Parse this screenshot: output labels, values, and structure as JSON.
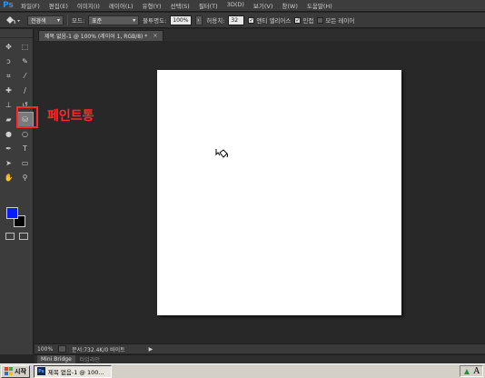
{
  "menubar": {
    "logo": "Ps",
    "items": [
      "파일(F)",
      "편집(E)",
      "이미지(I)",
      "레이어(L)",
      "유형(Y)",
      "선택(S)",
      "필터(T)",
      "3D(D)",
      "보기(V)",
      "창(W)",
      "도움말(H)"
    ]
  },
  "options": {
    "fill_source": "전경색",
    "mode_label": "모드:",
    "mode_value": "표준",
    "opacity_label": "불투명도:",
    "opacity_value": "100%",
    "tolerance_label": "허용치:",
    "tolerance_value": "32",
    "antialias_label": "앤티 앨리어스",
    "antialias_checked": true,
    "contiguous_label": "인접",
    "contiguous_checked": true,
    "all_layers_label": "모든 레이어",
    "all_layers_checked": false
  },
  "document": {
    "tab_title": "제목 없음-1 @ 100% (레이어 1, RGB/8) *",
    "close_glyph": "×",
    "canvas_color": "#ffffff"
  },
  "tools": [
    {
      "name": "move-tool-icon",
      "glyph": "✥"
    },
    {
      "name": "marquee-tool-icon",
      "glyph": "⬚"
    },
    {
      "name": "lasso-tool-icon",
      "glyph": "ↄ"
    },
    {
      "name": "quick-select-tool-icon",
      "glyph": "✎"
    },
    {
      "name": "crop-tool-icon",
      "glyph": "⌗"
    },
    {
      "name": "eyedropper-tool-icon",
      "glyph": "⁄"
    },
    {
      "name": "healing-brush-tool-icon",
      "glyph": "✚"
    },
    {
      "name": "brush-tool-icon",
      "glyph": "∕"
    },
    {
      "name": "clone-stamp-tool-icon",
      "glyph": "⊥"
    },
    {
      "name": "history-brush-tool-icon",
      "glyph": "↺"
    },
    {
      "name": "eraser-tool-icon",
      "glyph": "▰"
    },
    {
      "name": "paint-bucket-tool-icon",
      "glyph": "⛁",
      "active": true
    },
    {
      "name": "blur-tool-icon",
      "glyph": "●"
    },
    {
      "name": "dodge-tool-icon",
      "glyph": "○"
    },
    {
      "name": "pen-tool-icon",
      "glyph": "✒"
    },
    {
      "name": "type-tool-icon",
      "glyph": "T"
    },
    {
      "name": "path-select-tool-icon",
      "glyph": "➤"
    },
    {
      "name": "shape-tool-icon",
      "glyph": "▭"
    },
    {
      "name": "hand-tool-icon",
      "glyph": "✋"
    },
    {
      "name": "zoom-tool-icon",
      "glyph": "⚲"
    }
  ],
  "colors": {
    "foreground": "#0a1aff",
    "background": "#000000",
    "annotation": "#ff2a2a"
  },
  "annotation": {
    "label": "페인트통"
  },
  "status": {
    "zoom": "100%",
    "doc_info": "문서:732.4K/0 바이트",
    "arrow": "▶"
  },
  "bottom_tabs": [
    {
      "label": "Mini Bridge",
      "active": true
    },
    {
      "label": "타임라인",
      "active": false
    }
  ],
  "taskbar": {
    "start_label": "시작",
    "task_label": "제목 없음-1 @ 100...",
    "ps_icon_text": "Ps",
    "tray_letter": "A"
  }
}
